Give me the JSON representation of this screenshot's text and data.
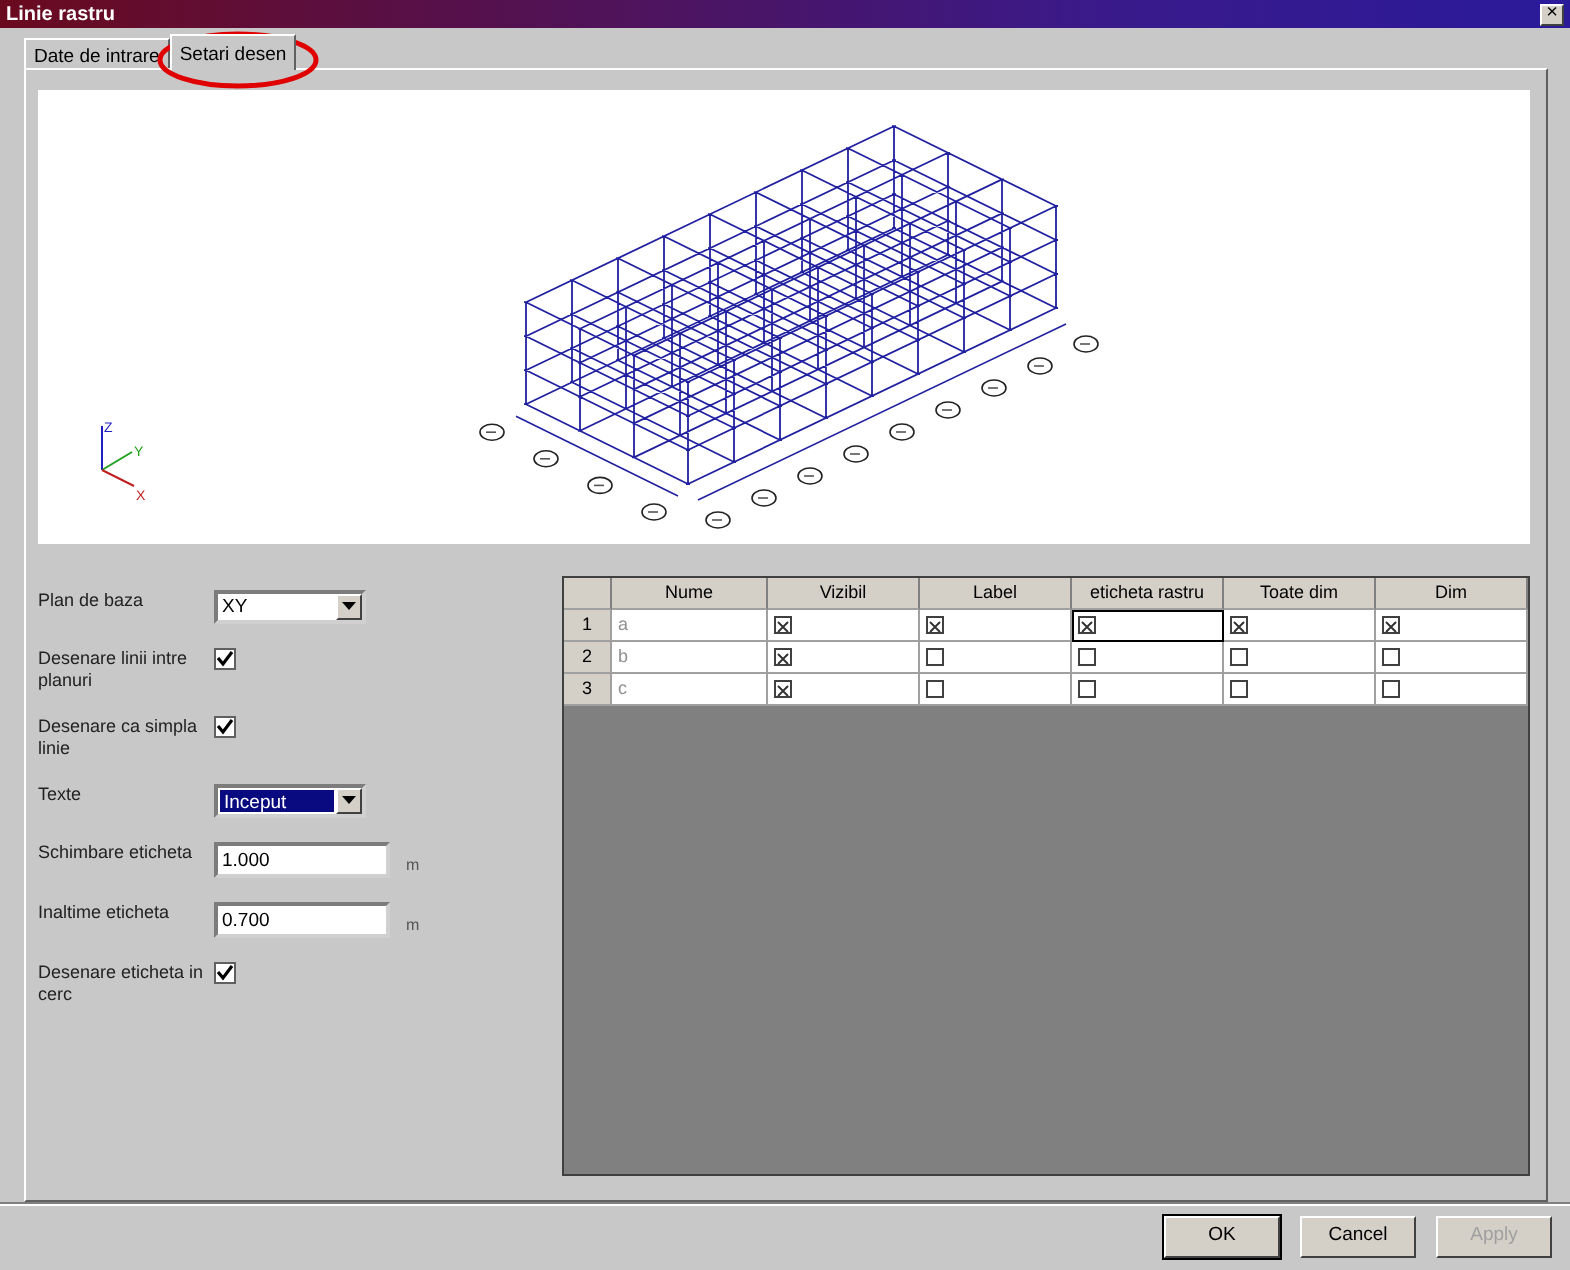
{
  "window": {
    "title": "Linie rastru",
    "close": "×"
  },
  "tabs": [
    {
      "label": "Date de intrare",
      "selected": false
    },
    {
      "label": "Setari desen",
      "selected": true,
      "highlighted": true
    }
  ],
  "preview": {
    "axes": [
      "Z",
      "Y",
      "X"
    ]
  },
  "form": [
    {
      "kind": "select",
      "label": "Plan de baza",
      "value": "XY",
      "focused": false
    },
    {
      "kind": "check",
      "label": "Desenare linii intre planuri",
      "checked": true
    },
    {
      "kind": "check",
      "label": "Desenare ca simpla linie",
      "checked": true
    },
    {
      "kind": "select",
      "label": "Texte",
      "value": "Inceput",
      "focused": true
    },
    {
      "kind": "input",
      "label": "Schimbare eticheta",
      "value": "1.000",
      "unit": "m"
    },
    {
      "kind": "input",
      "label": "Inaltime eticheta",
      "value": "0.700",
      "unit": "m"
    },
    {
      "kind": "check",
      "label": "Desenare eticheta in cerc",
      "checked": true
    }
  ],
  "table": {
    "columns": [
      "Nume",
      "Vizibil",
      "Label",
      "eticheta rastru",
      "Toate dim",
      "Dim"
    ],
    "rows": [
      {
        "number": "1",
        "name": "a",
        "cells": [
          {
            "checked": true,
            "focused": false
          },
          {
            "checked": true,
            "focused": false
          },
          {
            "checked": true,
            "focused": true
          },
          {
            "checked": true,
            "focused": false
          },
          {
            "checked": true,
            "focused": false
          }
        ]
      },
      {
        "number": "2",
        "name": "b",
        "cells": [
          {
            "checked": true,
            "focused": false
          },
          {
            "checked": false,
            "focused": false
          },
          {
            "checked": false,
            "focused": false
          },
          {
            "checked": false,
            "focused": false
          },
          {
            "checked": false,
            "focused": false
          }
        ]
      },
      {
        "number": "3",
        "name": "c",
        "cells": [
          {
            "checked": true,
            "focused": false
          },
          {
            "checked": false,
            "focused": false
          },
          {
            "checked": false,
            "focused": false
          },
          {
            "checked": false,
            "focused": false
          },
          {
            "checked": false,
            "focused": false
          }
        ]
      }
    ]
  },
  "buttons": [
    {
      "label": "OK",
      "disabled": false
    },
    {
      "label": "Cancel",
      "disabled": false
    },
    {
      "label": "Apply",
      "disabled": true
    }
  ]
}
